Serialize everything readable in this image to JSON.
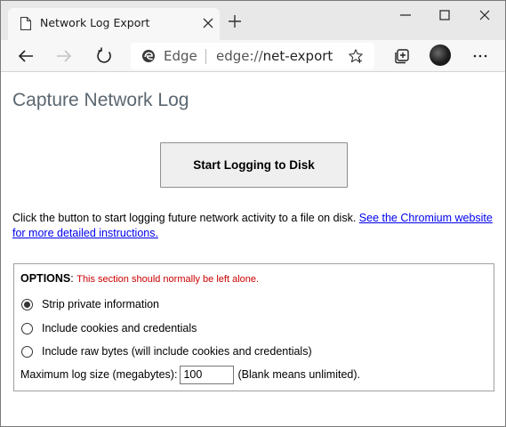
{
  "tab": {
    "title": "Network Log Export"
  },
  "omnibox": {
    "site_name": "Edge",
    "url_scheme": "edge://",
    "url_path": "net-export"
  },
  "page": {
    "title": "Capture Network Log",
    "start_button": "Start Logging to Disk",
    "instructions_text": "Click the button to start logging future network activity to a file on disk. ",
    "instructions_link": "See the Chromium website for more detailed instructions."
  },
  "options": {
    "label": "OPTIONS",
    "colon": ": ",
    "warning": "This section should normally be left alone.",
    "radios": [
      {
        "label": "Strip private information",
        "checked": true
      },
      {
        "label": "Include cookies and credentials",
        "checked": false
      },
      {
        "label": "Include raw bytes (will include cookies and credentials)",
        "checked": false
      }
    ],
    "max_size_label": "Maximum log size (megabytes):",
    "max_size_value": "100",
    "max_size_hint": "(Blank means unlimited)."
  },
  "colors": {
    "title": "#5b6770",
    "warning": "#cc0000",
    "link": "#0000ee"
  }
}
